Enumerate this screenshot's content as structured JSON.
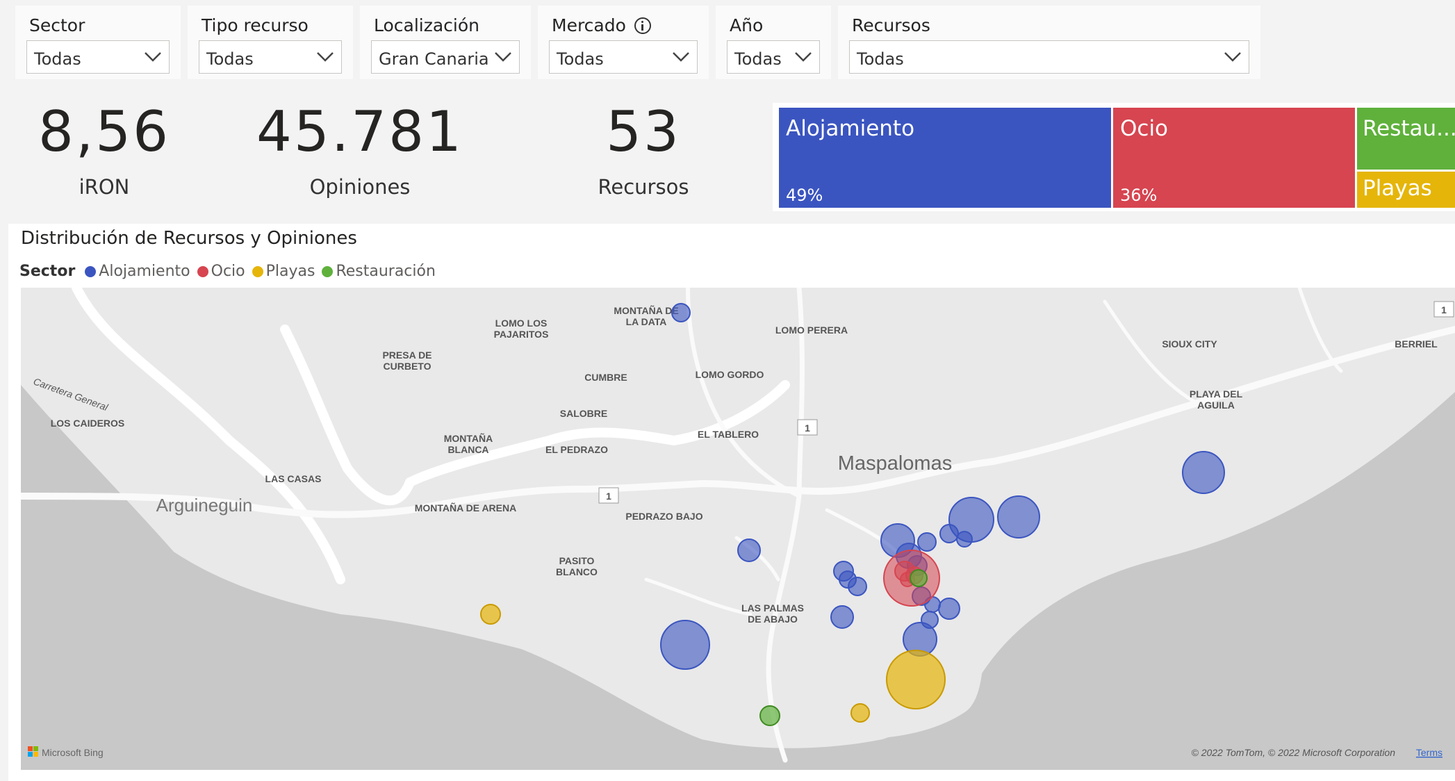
{
  "slicers": [
    {
      "title": "Sector",
      "value": "Todas"
    },
    {
      "title": "Tipo recurso",
      "value": "Todas"
    },
    {
      "title": "Localización",
      "value": "Gran Canaria"
    },
    {
      "title": "Mercado",
      "value": "Todas",
      "info_icon": "info-icon"
    },
    {
      "title": "Año",
      "value": "Todas"
    },
    {
      "title": "Recursos",
      "value": "Todas"
    }
  ],
  "kpis": [
    {
      "value": "8,56",
      "label": "iRON"
    },
    {
      "value": "45.781",
      "label": "Opiniones"
    },
    {
      "value": "53",
      "label": "Recursos"
    }
  ],
  "treemap": [
    {
      "name": "Alojamiento",
      "pct": "49%",
      "color": "#3b55c0"
    },
    {
      "name": "Ocio",
      "pct": "36%",
      "color": "#d64550"
    },
    {
      "name": "Restau...",
      "pct": "",
      "color": "#5fb13c"
    },
    {
      "name": "Playas",
      "pct": "",
      "color": "#e5b50a"
    }
  ],
  "map": {
    "title": "Distribución de Recursos y Opiniones",
    "legend_title": "Sector",
    "legend": [
      {
        "name": "Alojamiento",
        "color": "#3b55c0"
      },
      {
        "name": "Ocio",
        "color": "#d64550"
      },
      {
        "name": "Playas",
        "color": "#e5b50a"
      },
      {
        "name": "Restauración",
        "color": "#5fb13c"
      }
    ],
    "labels": {
      "montana_data": "MONTAÑA DE",
      "montana_data2": "LA DATA",
      "lomo_pajaritos": "LOMO LOS",
      "lomo_pajaritos2": "PAJARITOS",
      "lomo_perera": "LOMO PERERA",
      "presa": "PRESA DE",
      "presa2": "CURBETO",
      "cumbre": "CUMBRE",
      "lomo_gordo": "LOMO GORDO",
      "sioux": "SIOUX CITY",
      "berriel": "BERRIEL",
      "playa_aguila": "PLAYA DEL",
      "playa_aguila2": "AGUILA",
      "carretera": "Carretera General",
      "caideros": "LOS CAIDEROS",
      "salobre": "SALOBRE",
      "tablero": "EL TABLERO",
      "montana_blanca": "MONTAÑA",
      "montana_blanca2": "BLANCA",
      "pedrazo": "EL PEDRAZO",
      "maspalomas": "Maspalomas",
      "las_casas": "LAS CASAS",
      "arguineguin": "Arguineguin",
      "arena": "MONTAÑA DE ARENA",
      "pedrazo_bajo": "PEDRAZO BAJO",
      "pasito": "PASITO",
      "pasito2": "BLANCO",
      "palmas": "LAS PALMAS",
      "palmas2": "DE ABAJO",
      "road1": "1",
      "bing": "Microsoft Bing",
      "copyright": "© 2022 TomTom, © 2022 Microsoft Corporation",
      "terms": "Terms"
    }
  }
}
